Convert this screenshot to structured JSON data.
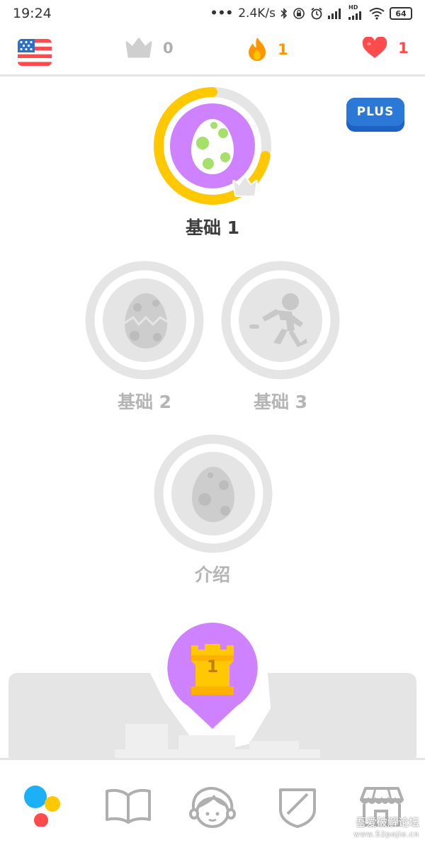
{
  "status_bar": {
    "time": "19:24",
    "dots": "•••",
    "network_speed": "2.4K/s",
    "battery": "64",
    "hd_label": "HD"
  },
  "top_bar": {
    "crowns": "0",
    "streak": "1",
    "hearts": "1",
    "plus_label": "PLUS"
  },
  "lessons": {
    "basics1": {
      "label": "基础 1",
      "progress": 0.72
    },
    "basics2": {
      "label": "基础 2"
    },
    "basics3": {
      "label": "基础 3"
    },
    "intro": {
      "label": "介绍"
    }
  },
  "checkpoint": {
    "number": "1"
  },
  "watermark": {
    "line1": "吾爱破解论坛",
    "line2": "www.52pojie.cn"
  },
  "colors": {
    "gold": "#ffc800",
    "purple": "#ce82ff",
    "locked_gray": "#e5e5e5",
    "egg_green": "#a5e06b",
    "streak_orange": "#ff9600",
    "heart_red": "#ff4b4b",
    "plus_blue": "#2b78d6"
  }
}
